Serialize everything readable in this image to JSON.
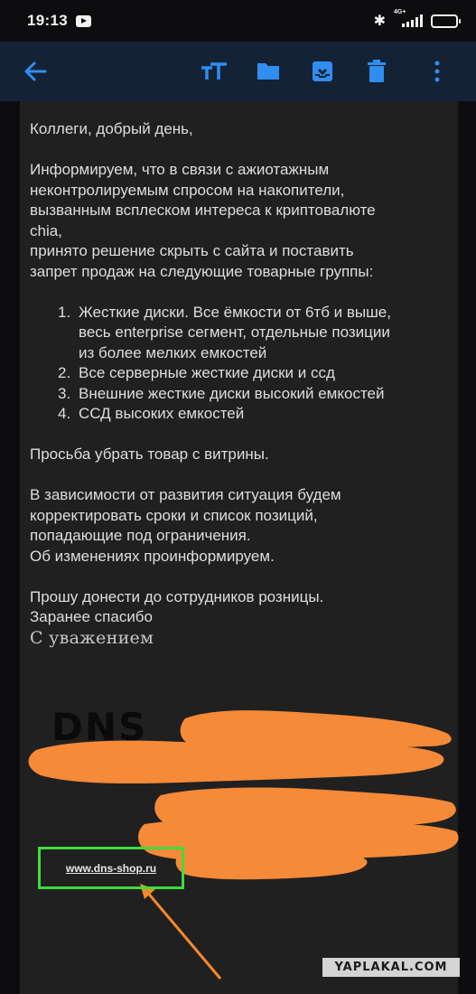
{
  "status_bar": {
    "time": "19:13",
    "network": "4G+",
    "battery_level": 0.85,
    "icons": [
      "youtube-icon",
      "bluetooth-icon",
      "signal-icon",
      "battery-icon"
    ]
  },
  "toolbar": {
    "icons": [
      "back-arrow-icon",
      "text-size-icon",
      "folder-icon",
      "archive-icon",
      "trash-icon",
      "more-vert-icon"
    ],
    "accent": "#2f8ef0",
    "background": "#142235"
  },
  "email": {
    "greeting": "Коллеги, добрый день,",
    "intro_lines": [
      "Информируем, что в связи с ажиотажным",
      "неконтролируемым спросом на накопители,",
      "вызванным всплеском интереса к криптовалюте",
      "chia,",
      "принято решение скрыть с сайта и поставить",
      "запрет продаж на следующие товарные группы:"
    ],
    "list": [
      {
        "num": "1.",
        "lines": [
          "Жесткие диски. Все ёмкости от 6тб и выше,",
          "весь enterprise сегмент, отдельные позиции",
          "из более мелких емкостей"
        ]
      },
      {
        "num": "2.",
        "lines": [
          "Все серверные жесткие диски и ссд"
        ]
      },
      {
        "num": "3.",
        "lines": [
          "Внешние жесткие диски высокий емкостей"
        ]
      },
      {
        "num": "4.",
        "lines": [
          "ССД высоких емкостей"
        ]
      }
    ],
    "request": "Просьба убрать товар с витрины.",
    "followup_lines": [
      "В зависимости от развития ситуация будем",
      "корректировать сроки и список позиций,",
      "попадающие под ограничения.",
      "Об изменениях проинформируем."
    ],
    "closing_lines": [
      "Прошу донести до сотрудников розницы.",
      "Заранее спасибо"
    ],
    "regards": "С уважением",
    "logo_text": "DNS",
    "website": "www.dns-shop.ru"
  },
  "annotations": {
    "highlight_color": "#3edc3e",
    "arrow_color": "#f58a2a",
    "redaction_color": "#f58a38"
  },
  "watermark": "YAPLAKAL.COM"
}
